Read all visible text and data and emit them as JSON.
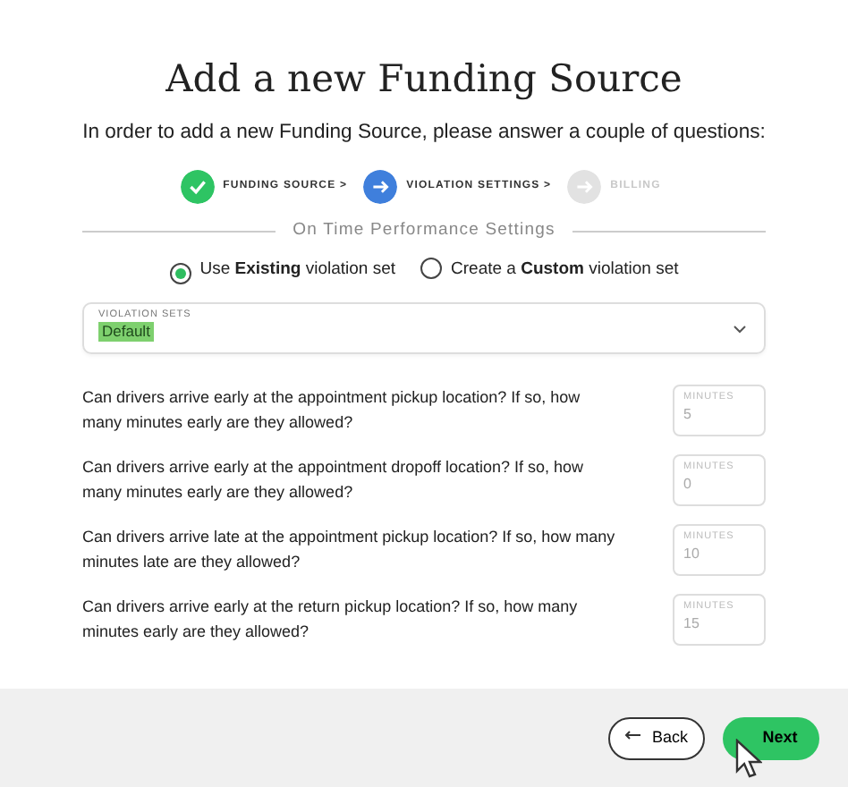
{
  "title": "Add a new Funding Source",
  "subtitle": "In order to add a new Funding Source, please answer a couple of questions:",
  "steps": [
    {
      "label": "FUNDING SOURCE >",
      "completed": true,
      "current": false
    },
    {
      "label": "VIOLATION SETTINGS >",
      "completed": false,
      "current": true
    },
    {
      "label": "BILLING",
      "completed": false,
      "current": false
    }
  ],
  "section_title": "On Time Performance Settings",
  "radios": [
    {
      "label": "Use **Existing** violation set",
      "selected": true
    },
    {
      "label": "Create a **Custom** violation set",
      "selected": false
    }
  ],
  "select": {
    "label": "VIOLATION SETS",
    "value": "Default"
  },
  "questions": [
    {
      "text": "Can drivers arrive early at the appointment pickup location? If so, how many minutes early are they allowed?",
      "field_label": "MINUTES",
      "placeholder": "5"
    },
    {
      "text": "Can drivers arrive early at the appointment dropoff location? If so, how many minutes early are they allowed?",
      "field_label": "MINUTES",
      "placeholder": "0"
    },
    {
      "text": "Can drivers arrive late at the appointment pickup location? If so, how many minutes late are they allowed?",
      "field_label": "MINUTES",
      "placeholder": "10"
    },
    {
      "text": "Can drivers arrive early at the return pickup location? If so, how many minutes early are they allowed?",
      "field_label": "MINUTES",
      "placeholder": "15"
    }
  ],
  "buttons": [
    {
      "label": "Back",
      "kind": "back"
    },
    {
      "label": "Next",
      "kind": "next"
    }
  ]
}
